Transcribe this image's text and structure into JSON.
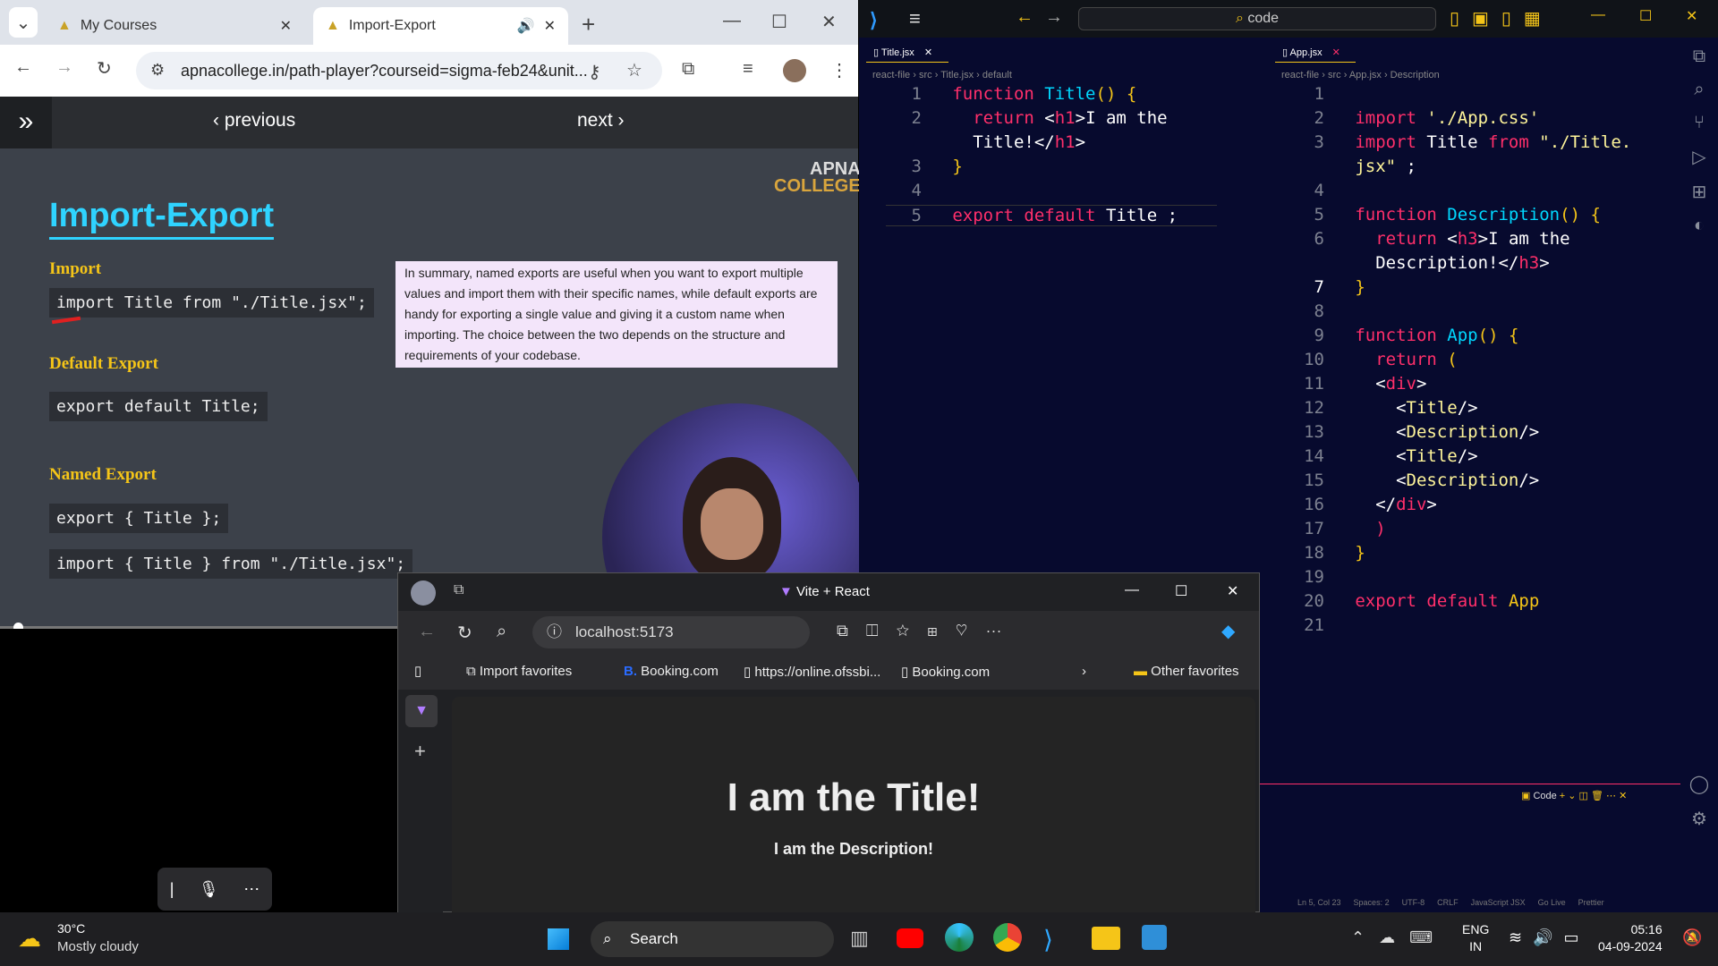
{
  "chrome": {
    "tabs": [
      {
        "label": "My Courses"
      },
      {
        "label": "Import-Export"
      }
    ],
    "url": "apnacollege.in/path-player?courseid=sigma-feb24&unit...",
    "nav": {
      "previous": "previous",
      "next": "next"
    },
    "logo_top": "APNA",
    "logo_bottom": "COLLEGE",
    "slide": {
      "title": "Import-Export",
      "import_h": "Import",
      "import_code": "import Title from \"./Title.jsx\";",
      "default_h": "Default Export",
      "default_code": "export default Title;",
      "named_h": "Named Export",
      "named_code1": "export { Title };",
      "named_code2": "import { Title } from \"./Title.jsx\";",
      "summary": "In summary, named exports are useful when you want to export multiple values and import them with their specific names, while default exports are handy for exporting a single value and giving it a custom name when importing. The choice between the two depends on the structure and requirements of your codebase."
    }
  },
  "vscode": {
    "search": "code",
    "left_tab": "Title.jsx",
    "right_tab": "App.jsx",
    "left_crumb": [
      "react-file",
      "src",
      "Title.jsx",
      "default"
    ],
    "right_crumb": [
      "react-file",
      "src",
      "App.jsx",
      "Description"
    ],
    "terminal_label": "Code",
    "status": [
      "Ln 5, Col 23",
      "Spaces: 2",
      "UTF-8",
      "CRLF",
      "JavaScript JSX",
      "Go Live",
      "Prettier"
    ]
  },
  "edge": {
    "title": "Vite + React",
    "url": "localhost:5173",
    "favorites": [
      "Import favorites",
      "Booking.com",
      "https://online.ofssbi...",
      "Booking.com",
      "Other favorites"
    ],
    "h1": "I am the Title!",
    "h3": "I am the Description!"
  },
  "taskbar": {
    "temp": "30°C",
    "weather": "Mostly cloudy",
    "search": "Search",
    "lang1": "ENG",
    "lang2": "IN",
    "time": "05:16",
    "date": "04-09-2024"
  }
}
